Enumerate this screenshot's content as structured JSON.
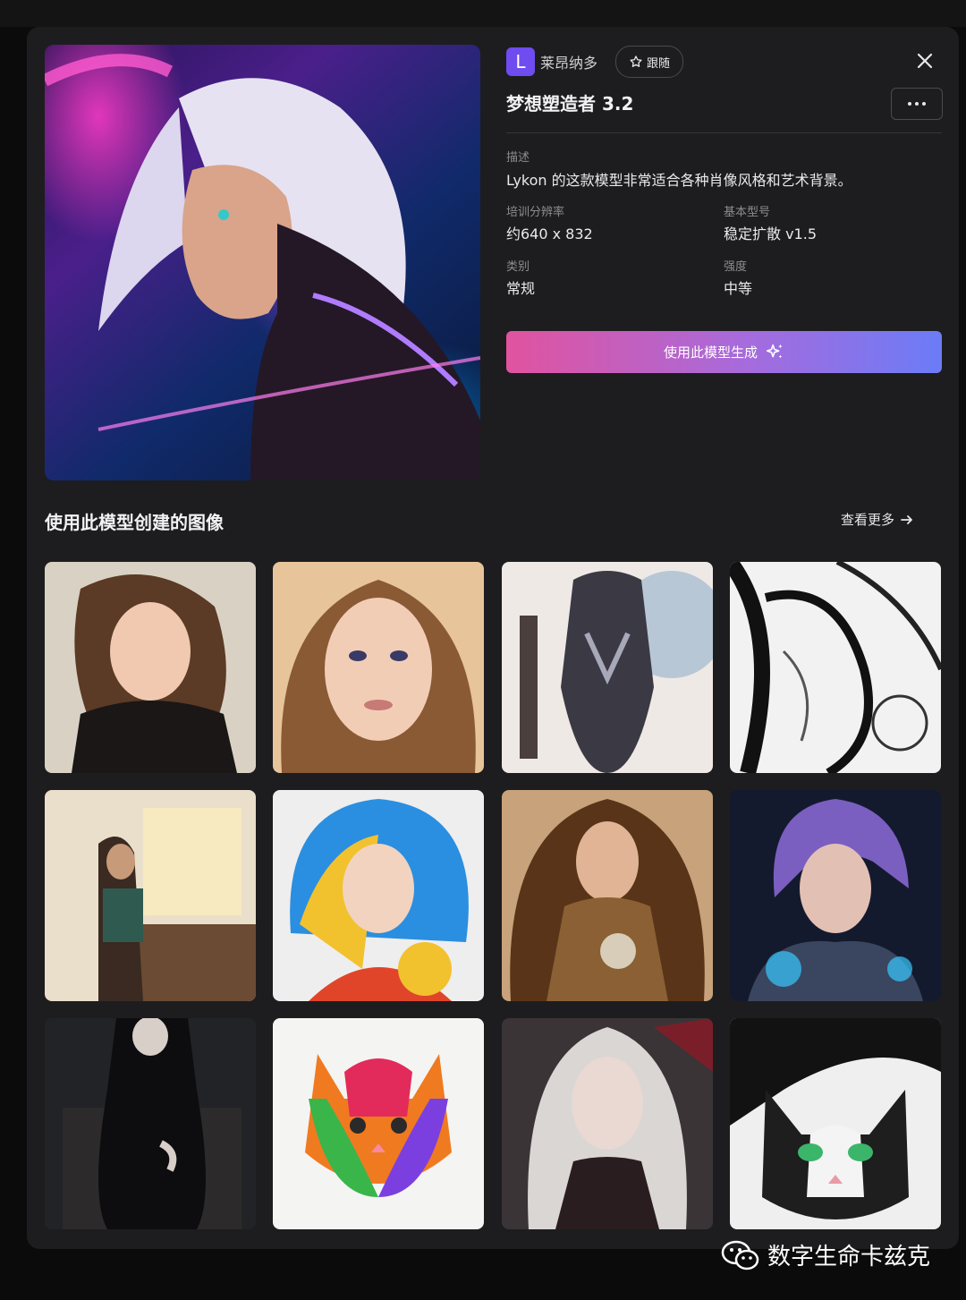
{
  "author": {
    "initial": "L",
    "name": "莱昂纳多"
  },
  "follow_label": "跟随",
  "model_title": "梦想塑造者 3.2",
  "description": {
    "label": "描述",
    "value": "Lykon 的这款模型非常适合各种肖像风格和艺术背景。"
  },
  "details": [
    {
      "label": "培训分辨率",
      "value": "约640 x 832"
    },
    {
      "label": "基本型号",
      "value": "稳定扩散 v1.5"
    },
    {
      "label": "类别",
      "value": "常规"
    },
    {
      "label": "强度",
      "value": "中等"
    }
  ],
  "generate_label": "使用此模型生成",
  "gallery": {
    "title": "使用此模型创建的图像",
    "see_more": "查看更多",
    "items": [
      {
        "subject": "anime girl with bob hair"
      },
      {
        "subject": "realistic woman portrait"
      },
      {
        "subject": "armored warrior woman"
      },
      {
        "subject": "ink line art woman"
      },
      {
        "subject": "girl in cozy room"
      },
      {
        "subject": "colorful splash girl"
      },
      {
        "subject": "steampunk woman"
      },
      {
        "subject": "cyberpunk girl with headphones"
      },
      {
        "subject": "gothic woman seated"
      },
      {
        "subject": "rainbow paint cat"
      },
      {
        "subject": "white haired woman"
      },
      {
        "subject": "black and white cat"
      }
    ]
  },
  "watermark": "数字生命卡兹克",
  "colors": {
    "accent_start": "#e1539f",
    "accent_end": "#6b7cf7",
    "avatar": "#6e4cf0"
  }
}
